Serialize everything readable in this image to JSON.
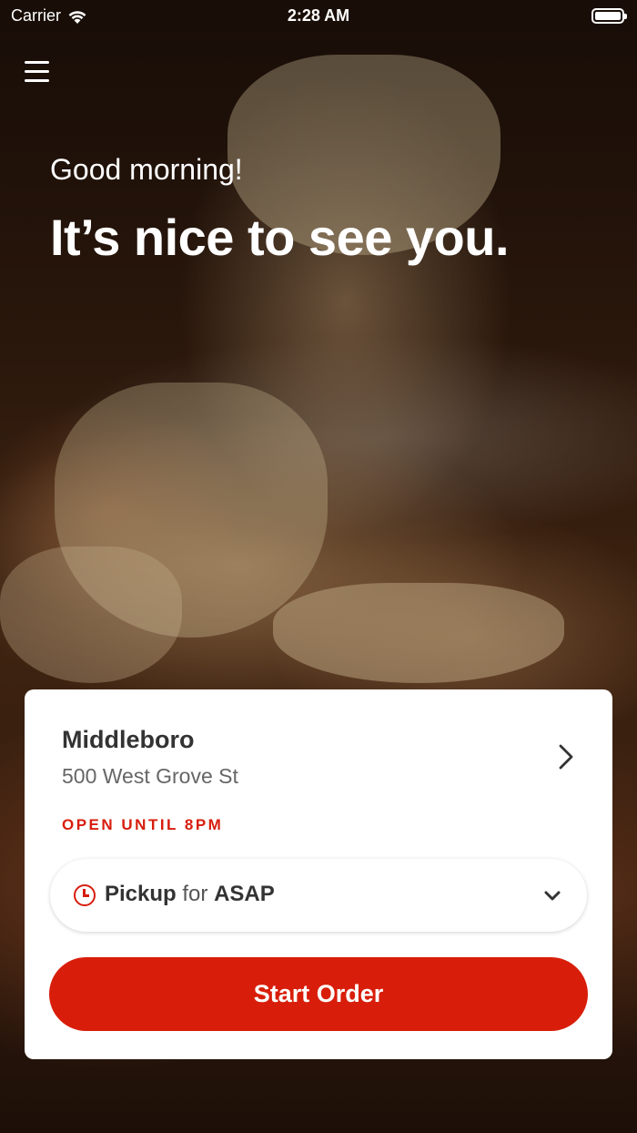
{
  "status_bar": {
    "carrier": "Carrier",
    "time": "2:28 AM",
    "wifi_icon": "wifi-icon",
    "battery_icon": "battery-icon"
  },
  "header": {
    "menu_icon": "hamburger-menu-icon",
    "greeting": "Good morning!",
    "headline": "It’s nice to see you."
  },
  "background": {
    "image": "cheesy-baked-pasta-photo"
  },
  "location_card": {
    "name": "Middleboro",
    "address": "500 West Grove St",
    "status": "OPEN UNTIL 8PM",
    "chevron_icon": "chevron-right-icon",
    "order_type": {
      "mode": "Pickup",
      "connector": "for",
      "time": "ASAP",
      "icon": "clock-icon",
      "dropdown_icon": "chevron-down-icon"
    },
    "start_order_label": "Start Order"
  },
  "colors": {
    "accent": "#d81e0a",
    "status_red": "#d71d0d",
    "card_bg": "#ffffff",
    "text_dark": "#333333",
    "text_muted": "#666666"
  }
}
